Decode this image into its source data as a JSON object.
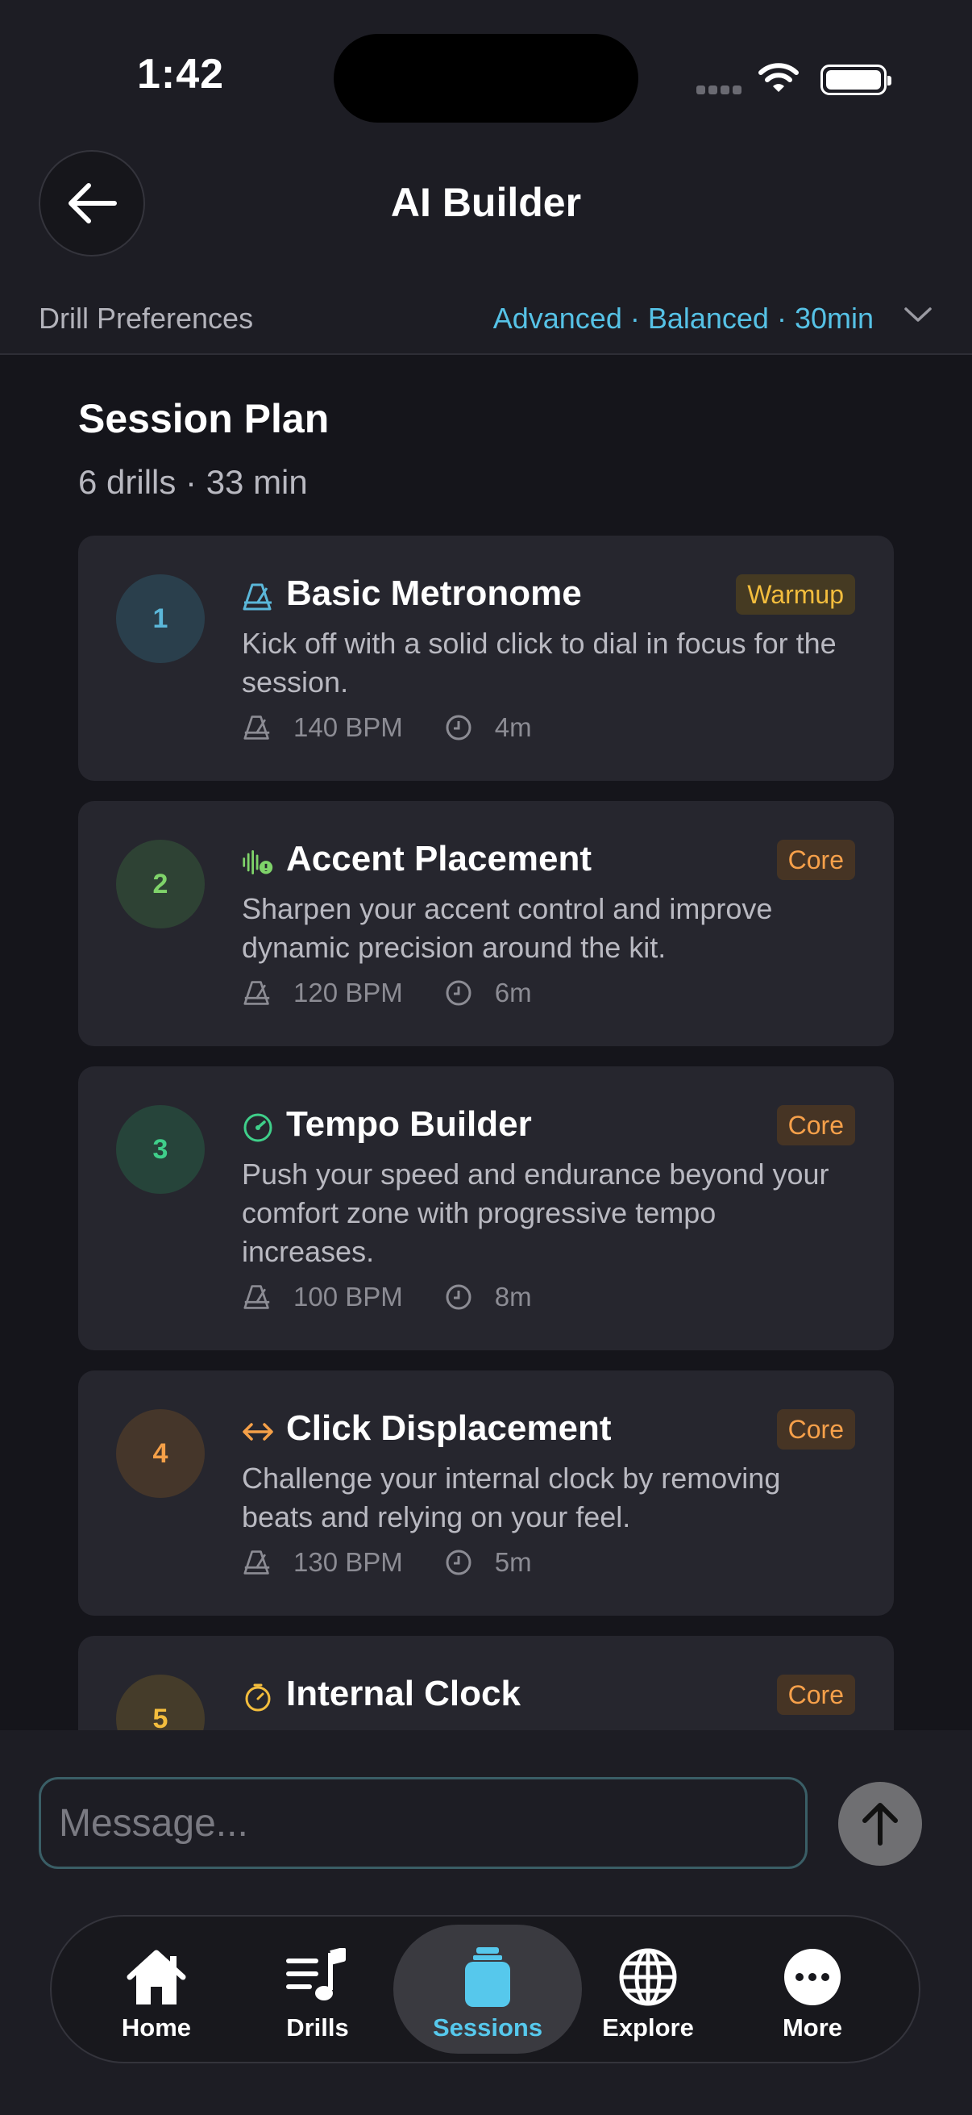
{
  "status_bar": {
    "time": "1:42"
  },
  "header": {
    "title": "AI Builder",
    "back_icon": "arrow-left-icon"
  },
  "preferences": {
    "label": "Drill Preferences",
    "value": "Advanced · Balanced · 30min",
    "accent_color": "#56c2e6"
  },
  "session": {
    "title": "Session Plan",
    "summary": "6 drills · 33 min",
    "drills": [
      {
        "number": "1",
        "icon": "metronome-icon",
        "title": "Basic Metronome",
        "badge": "Warmup",
        "description": "Kick off with a solid click to dial in focus for the session.",
        "bpm": "140 BPM",
        "duration": "4m",
        "color": "#5bb7d9"
      },
      {
        "number": "2",
        "icon": "waveform-alert-icon",
        "title": "Accent Placement",
        "badge": "Core",
        "description": "Sharpen your accent control and improve dynamic precision around the kit.",
        "bpm": "120 BPM",
        "duration": "6m",
        "color": "#7fd36a"
      },
      {
        "number": "3",
        "icon": "speedometer-icon",
        "title": "Tempo Builder",
        "badge": "Core",
        "description": "Push your speed and endurance beyond your comfort zone with progressive tempo increases.",
        "bpm": "100 BPM",
        "duration": "8m",
        "color": "#3fcf8a"
      },
      {
        "number": "4",
        "icon": "arrows-horizontal-icon",
        "title": "Click Displacement",
        "badge": "Core",
        "description": "Challenge your internal clock by removing beats and relying on your feel.",
        "bpm": "130 BPM",
        "duration": "5m",
        "color": "#f5a048"
      },
      {
        "number": "5",
        "icon": "timer-icon",
        "title": "Internal Clock",
        "badge": "Core",
        "description": "",
        "bpm": "",
        "duration": "",
        "color": "#f3bd3d"
      }
    ]
  },
  "composer": {
    "placeholder": "Message...",
    "send_icon": "arrow-up-icon"
  },
  "tabs": [
    {
      "label": "Home",
      "icon": "house-icon",
      "active": false
    },
    {
      "label": "Drills",
      "icon": "music-list-icon",
      "active": false
    },
    {
      "label": "Sessions",
      "icon": "jar-icon",
      "active": true
    },
    {
      "label": "Explore",
      "icon": "globe-icon",
      "active": false
    },
    {
      "label": "More",
      "icon": "ellipsis-circle-icon",
      "active": false
    }
  ]
}
